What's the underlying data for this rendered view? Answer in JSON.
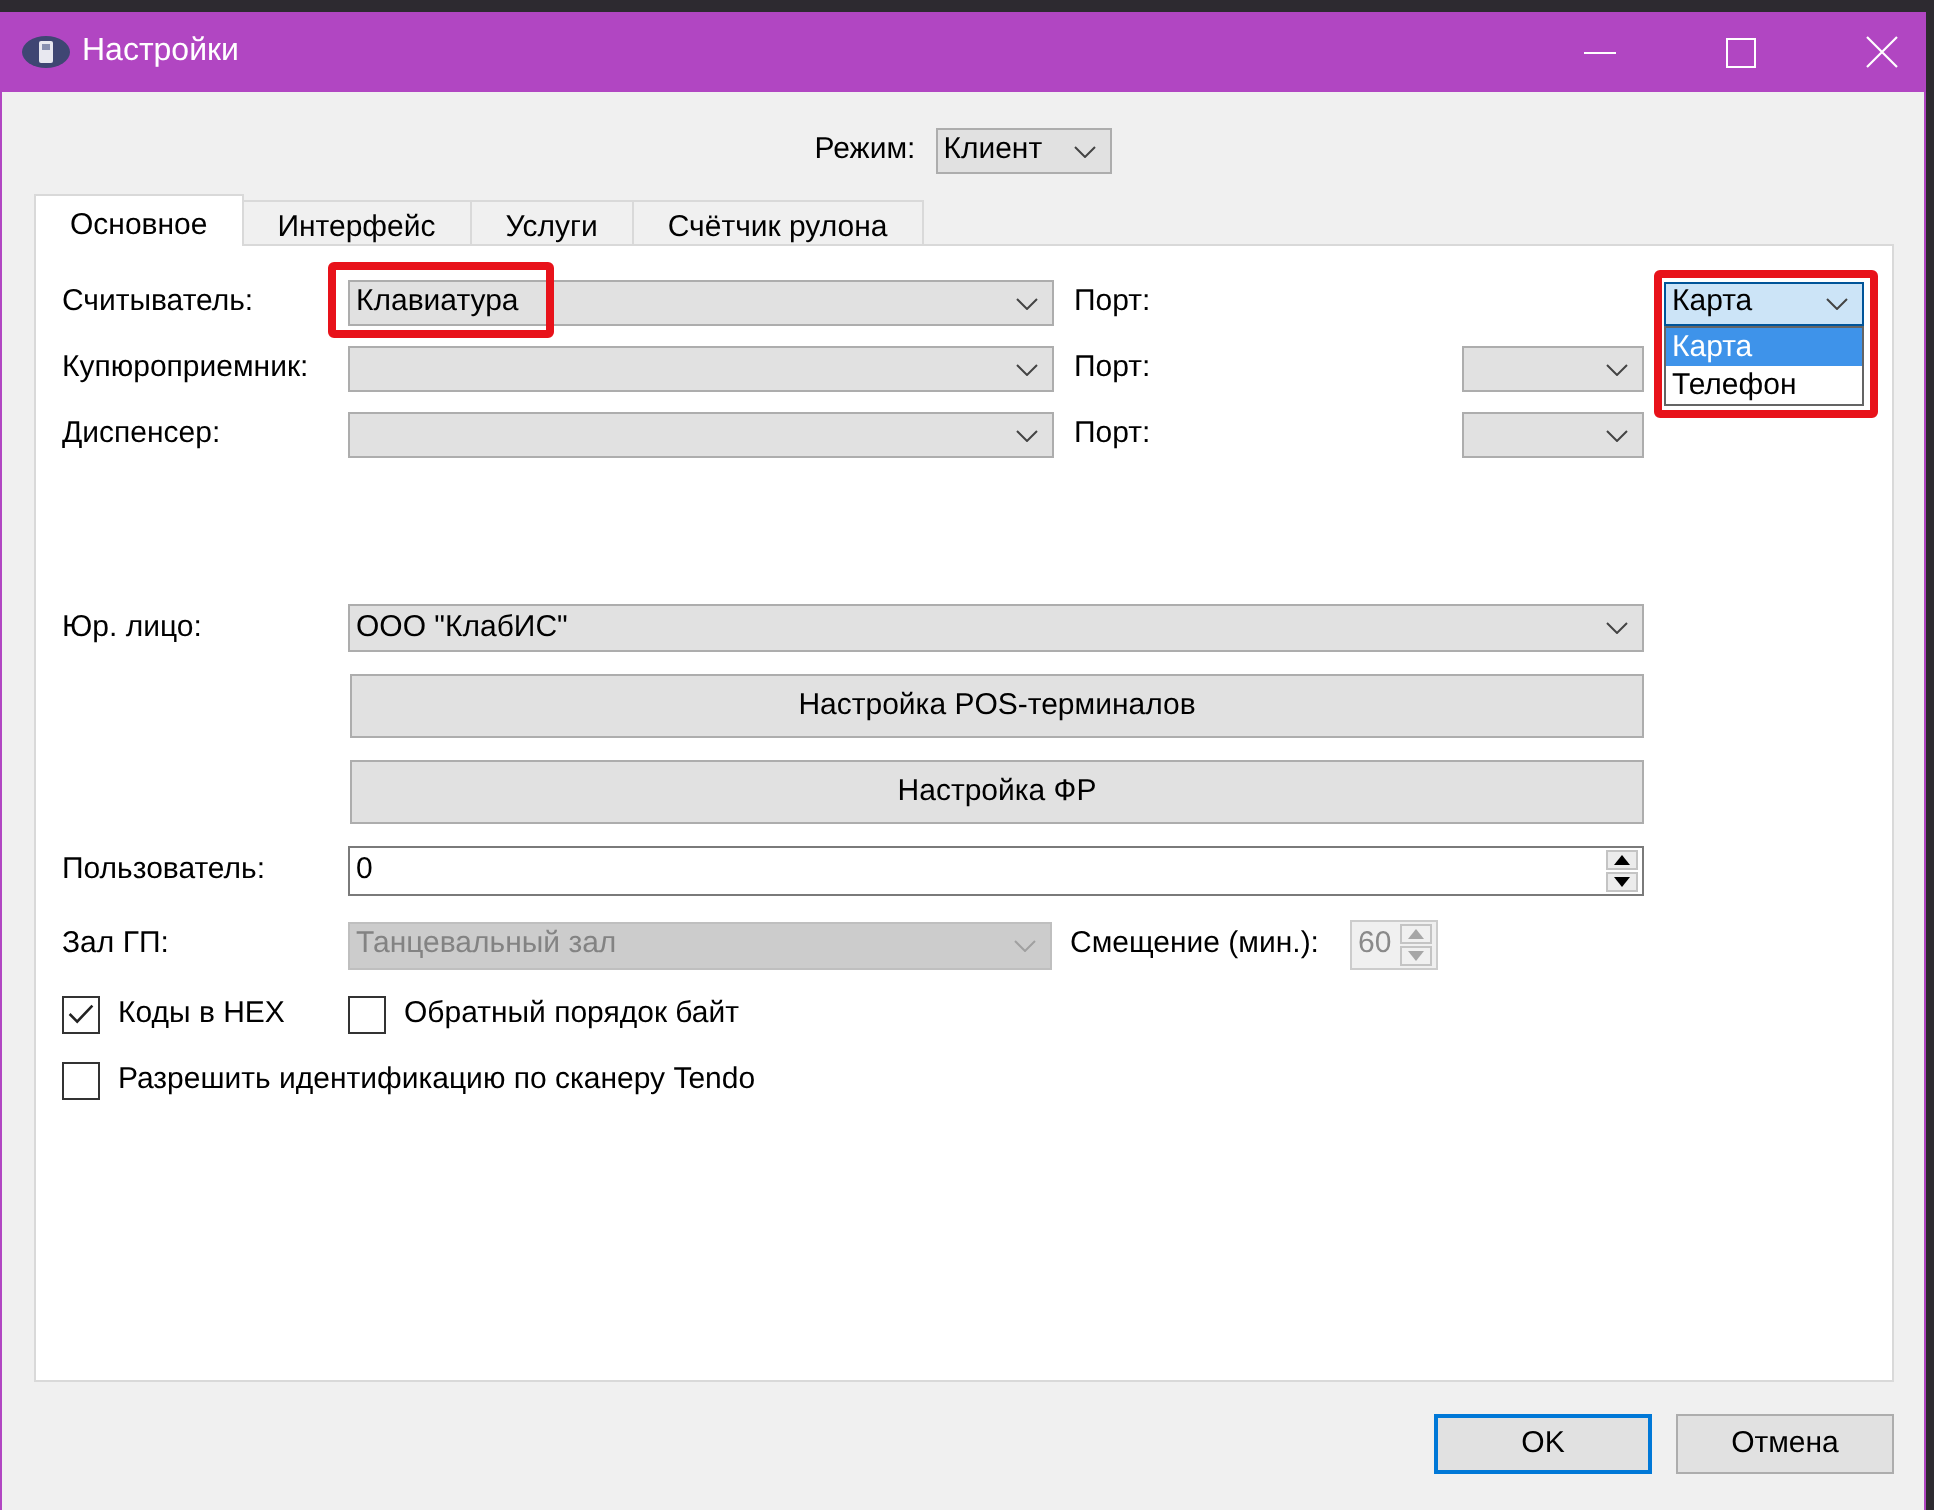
{
  "window": {
    "title": "Настройки"
  },
  "mode": {
    "label": "Режим:",
    "value": "Клиент"
  },
  "tabs": [
    {
      "label": "Основное",
      "selected": true
    },
    {
      "label": "Интерфейс",
      "selected": false
    },
    {
      "label": "Услуги",
      "selected": false
    },
    {
      "label": "Счётчик рулона",
      "selected": false
    }
  ],
  "devices": [
    {
      "label": "Считыватель:",
      "value": "Клавиатура",
      "highlighted": true,
      "port": {
        "label": "Порт:",
        "value": "Карта",
        "expanded": true,
        "highlighted": true,
        "options": [
          {
            "label": "Карта",
            "selected": true
          },
          {
            "label": "Телефон",
            "selected": false
          }
        ]
      }
    },
    {
      "label": "Купюроприемник:",
      "highlighted": false,
      "port": {
        "label": "Порт:",
        "expanded": false,
        "highlighted": false
      }
    },
    {
      "label": "Диспенсер:",
      "highlighted": false,
      "port": {
        "label": "Порт:",
        "expanded": false,
        "highlighted": false
      }
    }
  ],
  "legal_entity": {
    "label": "Юр. лицо:",
    "value": "ООО \"КлабИС\""
  },
  "setup_buttons": [
    "Настройка POS-терминалов",
    "Настройка ФР"
  ],
  "user": {
    "label": "Пользователь:",
    "value": "0"
  },
  "hall": {
    "label": "Зал ГП:",
    "value": "Танцевальный зал",
    "disabled": true
  },
  "offset": {
    "label": "Смещение (мин.):",
    "value": "60",
    "disabled": true
  },
  "checkbox_rows": [
    [
      {
        "label": "Коды в HEX",
        "checked": true
      },
      {
        "label": "Обратный порядок байт",
        "checked": false
      }
    ],
    [
      {
        "label": "Разрешить идентификацию по сканеру Tendo",
        "checked": false
      }
    ]
  ],
  "dialog_buttons": [
    {
      "label": "OK",
      "default": true
    },
    {
      "label": "Отмена",
      "default": false
    }
  ]
}
